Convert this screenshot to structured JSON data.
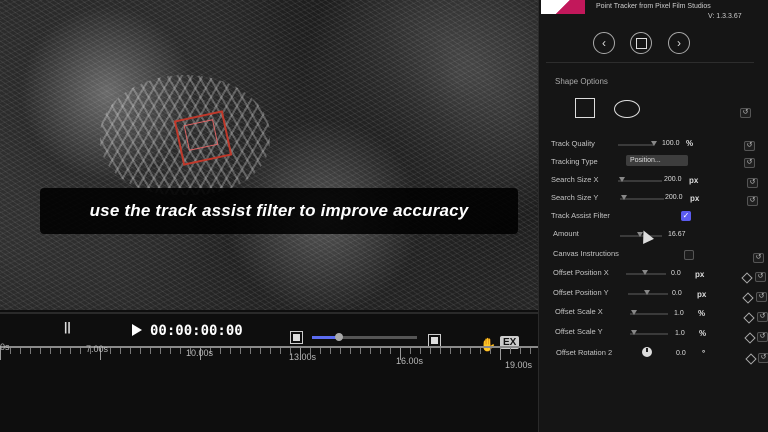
{
  "viewer": {
    "caption": "use the track assist filter to improve accuracy"
  },
  "player": {
    "timecode": "00:00:00:00",
    "pause_mark": "||",
    "ruler_labels": [
      "0s",
      "7.00s",
      "10.00s",
      "13.00s",
      "16.00s",
      "19.00s"
    ],
    "zoom_fraction": 0.26
  },
  "panel": {
    "product_title": "Point Tracker from Pixel Film Studios",
    "version": "V: 1.3.3.67",
    "section_title": "Shape Options",
    "rows": {
      "track_quality": {
        "label": "Track Quality",
        "value": "100.0",
        "unit": "%"
      },
      "tracking_type": {
        "label": "Tracking Type",
        "value": "Position..."
      },
      "search_size_x": {
        "label": "Search Size X",
        "value": "200.0",
        "unit": "px"
      },
      "search_size_y": {
        "label": "Search Size Y",
        "value": "200.0",
        "unit": "px"
      },
      "track_assist_filter": {
        "label": "Track Assist Filter",
        "checked": true
      },
      "amount": {
        "label": "Amount",
        "value": "16.67"
      },
      "canvas_instructions": {
        "label": "Canvas Instructions",
        "checked": false
      },
      "offset_position_x": {
        "label": "Offset Position X",
        "value": "0.0",
        "unit": "px"
      },
      "offset_position_y": {
        "label": "Offset Position Y",
        "value": "0.0",
        "unit": "px"
      },
      "offset_scale_x": {
        "label": "Offset Scale X",
        "value": "1.0",
        "unit": "%"
      },
      "offset_scale_y": {
        "label": "Offset Scale Y",
        "value": "1.0",
        "unit": "%"
      },
      "offset_rotation_2": {
        "label": "Offset Rotation 2",
        "value": "0.0",
        "unit": "°"
      }
    }
  },
  "icons": {
    "prev": "chevron-left-icon",
    "stop": "square-icon",
    "next": "chevron-right-icon",
    "reset": "reset-icon",
    "keyframe": "diamond-icon",
    "play": "play-icon",
    "hand": "hand-icon",
    "export": "export-icon"
  },
  "colors": {
    "accent": "#5b5bf0",
    "track_box": "#c0392b",
    "panel_bg": "#151515"
  }
}
